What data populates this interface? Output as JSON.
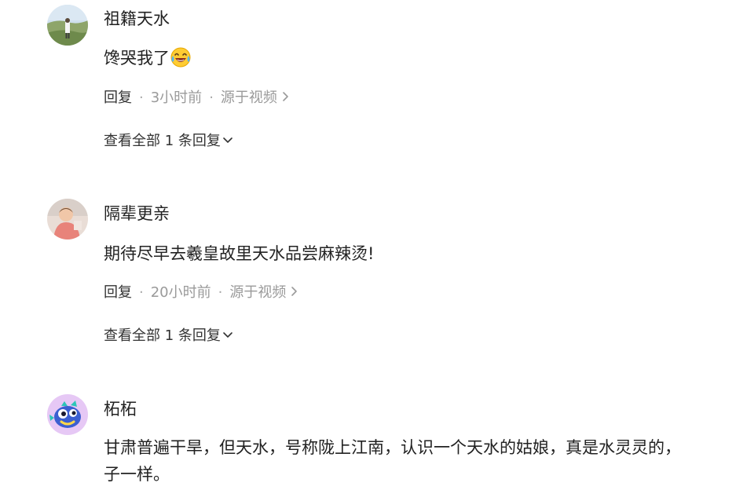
{
  "comments": [
    {
      "username": "祖籍天水",
      "text": "馋哭我了",
      "emoji": "laughing-crying-emoji",
      "reply_label": "回复",
      "time": "3小时前",
      "source": "源于视频",
      "expand_label": "查看全部 1 条回复"
    },
    {
      "username": "隔辈更亲",
      "text": "期待尽早去羲皇故里天水品尝麻辣烫!",
      "reply_label": "回复",
      "time": "20小时前",
      "source": "源于视频",
      "expand_label": "查看全部 1 条回复"
    },
    {
      "username": "柘柘",
      "text_line1": "甘肃普遍干旱，但天水，号称陇上江南，认识一个天水的姑娘，真是水灵灵的，",
      "text_line2": "子一样。"
    }
  ],
  "icons": {
    "chevron_right": "chevron-right-icon",
    "chevron_down": "chevron-down-icon"
  },
  "colors": {
    "text": "#222222",
    "meta": "#9a9a9a"
  }
}
